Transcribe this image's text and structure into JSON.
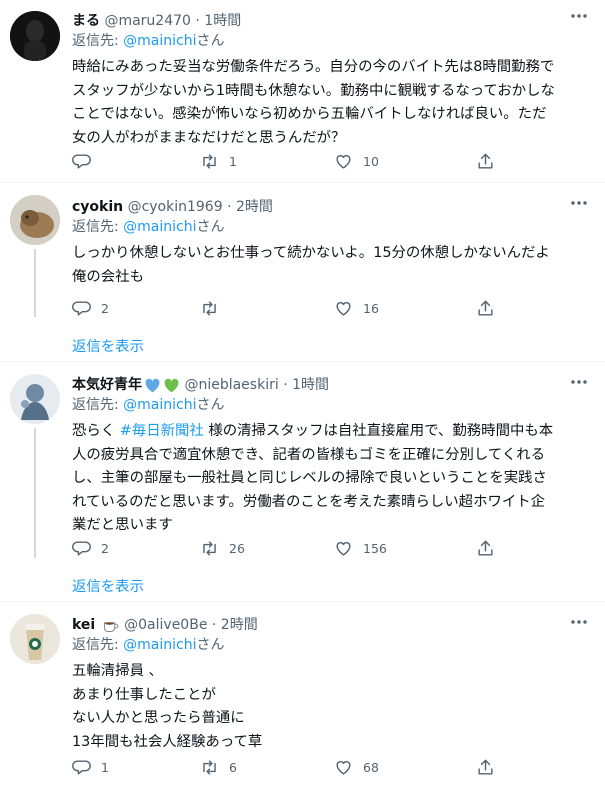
{
  "tweets": [
    {
      "name": "まる",
      "handle": "@maru2470",
      "sep": "·",
      "time": "1時間",
      "reply_prefix": "返信先: ",
      "reply_to": "@mainichi",
      "reply_suffix": "さん",
      "lines": [
        "時給にみあった妥当な労働条件だろう。自分の今のバイト先は8時間勤務で",
        "スタッフが少ないから1時間も休憩ない。勤務中に観戦するなっておかしな",
        "ことではない。感染が怖いなら初めから五輪バイトしなければ良い。ただ",
        "女の人がわがままなだけだと思うんだが？"
      ],
      "replies": "",
      "retweets": "1",
      "likes": "10"
    },
    {
      "name": "cyokin",
      "handle": "@cyokin1969",
      "sep": "·",
      "time": "2時間",
      "reply_prefix": "返信先: ",
      "reply_to": "@mainichi",
      "reply_suffix": "さん",
      "lines": [
        "しっかり休憩しないとお仕事って続かないよ。15分の休憩しかないんだよ",
        "俺の会社も"
      ],
      "replies": "2",
      "retweets": "",
      "likes": "16",
      "show_replies": "返信を表示"
    },
    {
      "name": "本気好青年",
      "handle": "@nieblaeskiri",
      "sep": "·",
      "time": "1時間",
      "reply_prefix": "返信先: ",
      "reply_to": "@mainichi",
      "reply_suffix": "さん",
      "line1_pre": "恐らく ",
      "hashtag": "#毎日新聞社",
      "line1_post": " 様の清掃スタッフは自社直接雇用で、勤務時間中も本",
      "lines": [
        "人の疲労具合で適宜休憩でき、記者の皆様もゴミを正確に分別してくれる",
        "し、主筆の部屋も一般社員と同じレベルの掃除で良いということを実践さ",
        "れているのだと思います。労働者のことを考えた素晴らしい超ホワイト企",
        "業だと思います"
      ],
      "replies": "2",
      "retweets": "26",
      "likes": "156",
      "show_replies": "返信を表示",
      "heart_colors": [
        "#5ea8e6",
        "#6cc04a"
      ]
    },
    {
      "name": "kei",
      "handle": "@0alive0Be",
      "sep": "·",
      "time": "2時間",
      "reply_prefix": "返信先: ",
      "reply_to": "@mainichi",
      "reply_suffix": "さん",
      "lines": [
        "五輪清掃員 、",
        "あまり仕事したことが",
        "ない人かと思ったら普通に",
        "13年間も社会人経験あって草"
      ],
      "replies": "1",
      "retweets": "6",
      "likes": "68"
    }
  ],
  "colors": {
    "link": "#1d9bf0",
    "secondary": "#536471",
    "text": "#0f1419"
  }
}
